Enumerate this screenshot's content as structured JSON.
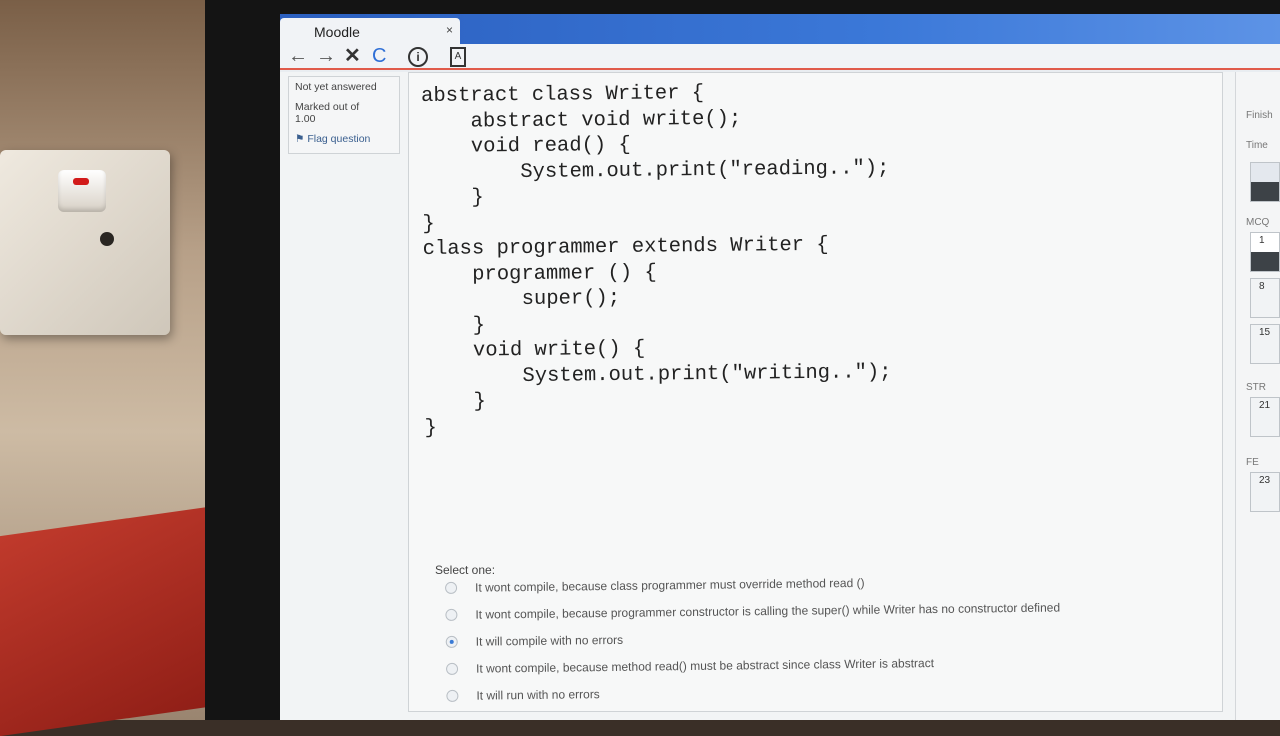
{
  "browser": {
    "tab_title": "Moodle",
    "tab_close": "×",
    "nav": {
      "back": "←",
      "forward": "→",
      "stop": "✕",
      "reload": "C",
      "info": "i",
      "pdf": "A"
    }
  },
  "question_info": {
    "status": "Not yet answered",
    "marked": "Marked out of",
    "mark_value": "1.00",
    "flag": "Flag question"
  },
  "code": {
    "lines": [
      "abstract class Writer {",
      "    abstract void write();",
      "    void read() {",
      "        System.out.print(\"reading..\");",
      "    }",
      "}",
      "class programmer extends Writer {",
      "    programmer () {",
      "        super();",
      "    }",
      "    void write() {",
      "        System.out.print(\"writing..\");",
      "    }",
      "}"
    ]
  },
  "answer": {
    "prompt": "Select one:",
    "options": [
      {
        "label": "It wont compile, because class programmer must override method read ()",
        "selected": false
      },
      {
        "label": "It wont compile, because  programmer constructor is calling the super() while Writer has no constructor defined",
        "selected": false
      },
      {
        "label": "It will compile with no errors",
        "selected": true
      },
      {
        "label": "It wont compile, because method read() must be abstract since class Writer is abstract",
        "selected": false
      },
      {
        "label": "It will run with no errors",
        "selected": false
      }
    ]
  },
  "quiz_nav": {
    "finish": "Finish",
    "time": "Time",
    "section_mcq": "MCQ",
    "section_str": "STR",
    "section_fe": "FE",
    "buttons": [
      "1",
      "8",
      "15",
      "21",
      "23"
    ]
  },
  "colors": {
    "titlebar": "#2b5fbf",
    "accent_line": "#e05a4a",
    "radio_selected": "#3a7bd5"
  }
}
